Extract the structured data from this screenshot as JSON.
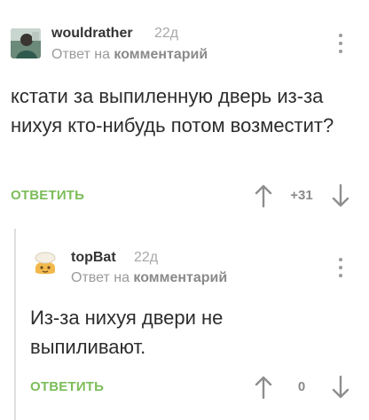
{
  "comments": [
    {
      "author": "wouldrather",
      "time": "22д",
      "reply_prefix": "Ответ на",
      "reply_target": "комментарий",
      "text": "кстати за выпиленную дверь из-за нихуя кто-нибудь потом возместит?",
      "reply_label": "ОТВЕТИТЬ",
      "score": "+31",
      "avatar_icon": "user-avatar-photo"
    },
    {
      "author": "topBat",
      "time": "22д",
      "reply_prefix": "Ответ на",
      "reply_target": "комментарий",
      "text": "Из-за нихуя двери не выпиливают.",
      "reply_label": "ОТВЕТИТЬ",
      "score": "0",
      "avatar_icon": "user-avatar-cartoon"
    }
  ],
  "colors": {
    "accent": "#7cbd59",
    "meta": "#a8a8a8",
    "text": "#2d2d2d",
    "thread_line": "#dedede"
  }
}
